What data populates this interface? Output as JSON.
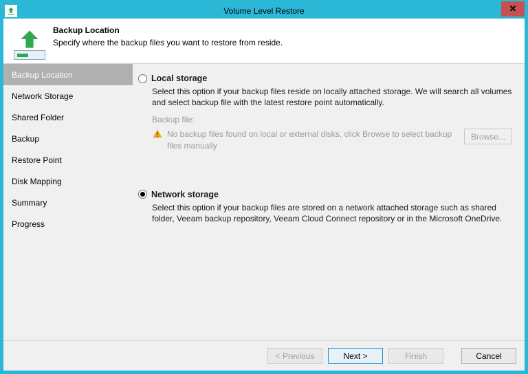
{
  "window": {
    "title": "Volume Level Restore"
  },
  "header": {
    "title": "Backup Location",
    "subtitle": "Specify where the backup files you want to restore from reside."
  },
  "sidebar": {
    "items": [
      {
        "label": "Backup Location"
      },
      {
        "label": "Network Storage"
      },
      {
        "label": "Shared Folder"
      },
      {
        "label": "Backup"
      },
      {
        "label": "Restore Point"
      },
      {
        "label": "Disk Mapping"
      },
      {
        "label": "Summary"
      },
      {
        "label": "Progress"
      }
    ]
  },
  "options": {
    "local": {
      "title": "Local storage",
      "desc": "Select this option if your backup files reside on locally attached storage. We will search all volumes and select backup file with the latest restore point automatically.",
      "file_label": "Backup file:",
      "warning": "No backup files found on local or external disks, click Browse to select backup files manually",
      "browse": "Browse..."
    },
    "network": {
      "title": "Network storage",
      "desc": "Select this option if your backup files are stored on a network attached storage such as shared folder, Veeam backup repository, Veeam Cloud Connect repository or in the Microsoft OneDrive."
    }
  },
  "footer": {
    "previous": "< Previous",
    "next": "Next >",
    "finish": "Finish",
    "cancel": "Cancel"
  }
}
